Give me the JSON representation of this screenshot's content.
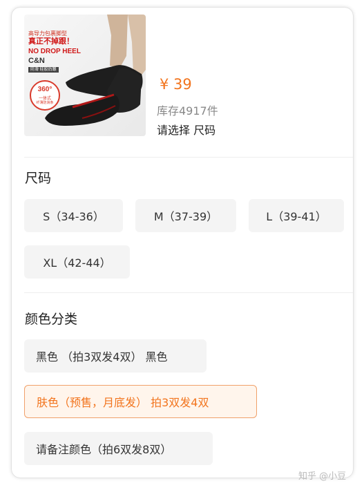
{
  "product": {
    "image_text": {
      "line1": "高导力包裹脚型",
      "line2": "真正不掉跟！",
      "line3": "NO DROP HEEL",
      "brand": "C&N",
      "tag": "防滑 硅胶后跟",
      "badge_degree": "360°",
      "badge_line1": "一体式",
      "badge_line2": "纤薄防滑条"
    },
    "price": "¥ 39",
    "stock": "库存4917件",
    "select_hint": "请选择 尺码"
  },
  "size_section": {
    "title": "尺码",
    "options": [
      "S（34-36）",
      "M（37-39）",
      "L（39-41）",
      "XL（42-44）"
    ]
  },
  "color_section": {
    "title": "颜色分类",
    "options": [
      "黑色 （拍3双发4双） 黑色",
      "肤色（预售，月底发） 拍3双发4双",
      "请备注颜色（拍6双发8双）"
    ],
    "selected_index": 1
  },
  "watermark": "知乎 @小豆",
  "colors": {
    "accent": "#f2741d",
    "chip_bg": "#f4f4f4",
    "selected_border": "#f0a069",
    "selected_bg": "#fff5ec"
  }
}
